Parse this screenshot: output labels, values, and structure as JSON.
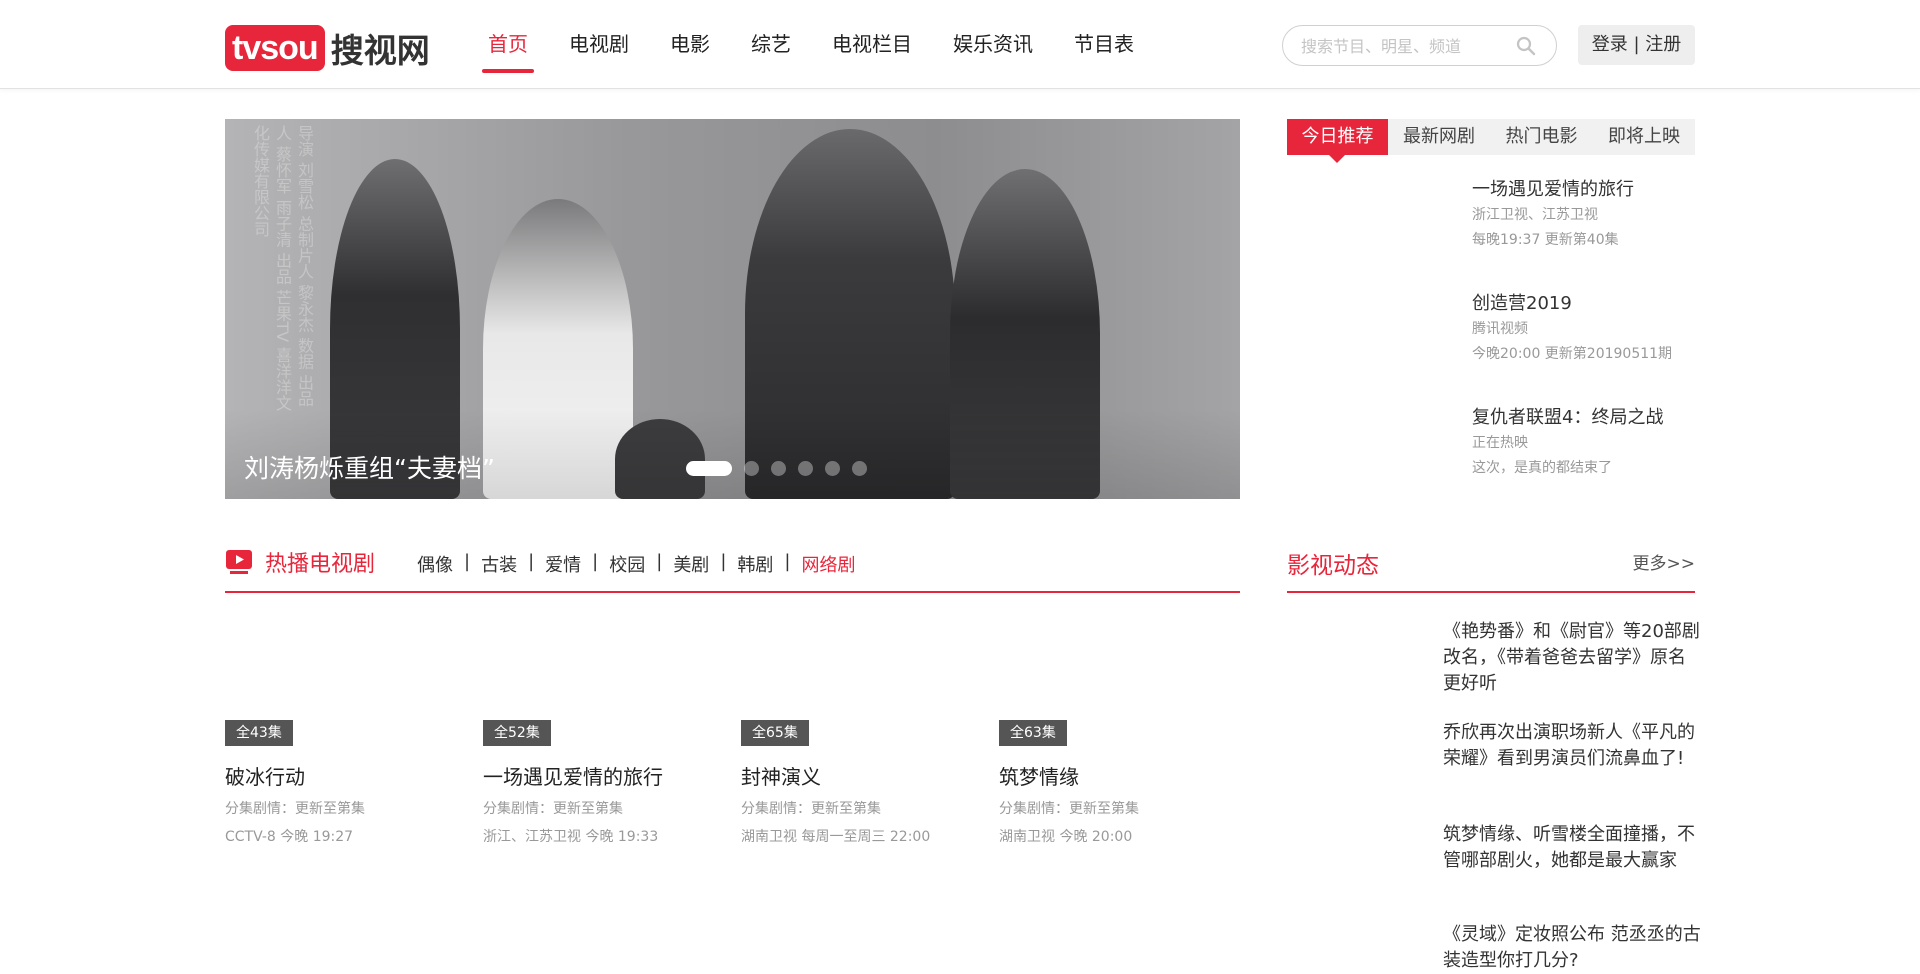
{
  "header": {
    "logo_badge": "tvsou",
    "logo_text": "搜视网",
    "nav": [
      "首页",
      "电视剧",
      "电影",
      "综艺",
      "电视栏目",
      "娱乐资讯",
      "节目表"
    ],
    "nav_active_index": 0,
    "search_placeholder": "搜索节目、明星、频道",
    "login_label": "登录 | 注册"
  },
  "banner": {
    "caption": "刘涛杨烁重组“夫妻档”",
    "vertical_text": "导演 刘雪松 总制片人 黎永杰 数据 出品人 蔡怀军 雨子清 出品 芒果TV 喜洋洋文化传媒有限公司",
    "dots": 6,
    "active_dot": 0
  },
  "recommend": {
    "tabs": [
      "今日推荐",
      "最新网剧",
      "热门电影",
      "即将上映"
    ],
    "active_tab": 0,
    "items": [
      {
        "title": "一场遇见爱情的旅行",
        "sub1": "浙江卫视、江苏卫视",
        "sub2": "每晚19:37 更新第40集"
      },
      {
        "title": "创造营2019",
        "sub1": "腾讯视频",
        "sub2": "今晚20:00 更新第20190511期"
      },
      {
        "title": "复仇者联盟4：终局之战",
        "sub1": "正在热映",
        "sub2": "这次，是真的都结束了"
      }
    ]
  },
  "hot_series": {
    "title": "热播电视剧",
    "categories": [
      "偶像",
      "古装",
      "爱情",
      "校园",
      "美剧",
      "韩剧",
      "网络剧"
    ],
    "active_category": 6,
    "cards": [
      {
        "episodes": "全43集",
        "title": "破冰行动",
        "status": "分集剧情：更新至第集",
        "meta": "CCTV-8 今晚 19:27"
      },
      {
        "episodes": "全52集",
        "title": "一场遇见爱情的旅行",
        "status": "分集剧情：更新至第集",
        "meta": "浙江、江苏卫视 今晚 19:33"
      },
      {
        "episodes": "全65集",
        "title": "封神演义",
        "status": "分集剧情：更新至第集",
        "meta": "湖南卫视 每周一至周三 22:00"
      },
      {
        "episodes": "全63集",
        "title": "筑梦情缘",
        "status": "分集剧情：更新至第集",
        "meta": "湖南卫视 今晚 20:00"
      }
    ]
  },
  "news": {
    "title": "影视动态",
    "more": "更多>>",
    "items": [
      {
        "text": "《艳势番》和《尉官》等20部剧改名，《带着爸爸去留学》原名更好听"
      },
      {
        "text": "乔欣再次出演职场新人《平凡的荣耀》看到男演员们流鼻血了!"
      },
      {
        "text": "筑梦情缘、听雪楼全面撞播，不管哪部剧火，她都是最大赢家"
      },
      {
        "text": "《灵域》定妆照公布 范丞丞的古装造型你打几分?"
      }
    ]
  },
  "colors": {
    "accent": "#e8263b",
    "badge": "#555555",
    "muted": "#999999"
  },
  "icons": {
    "search": "search-icon",
    "hot": "tv-play-icon"
  }
}
